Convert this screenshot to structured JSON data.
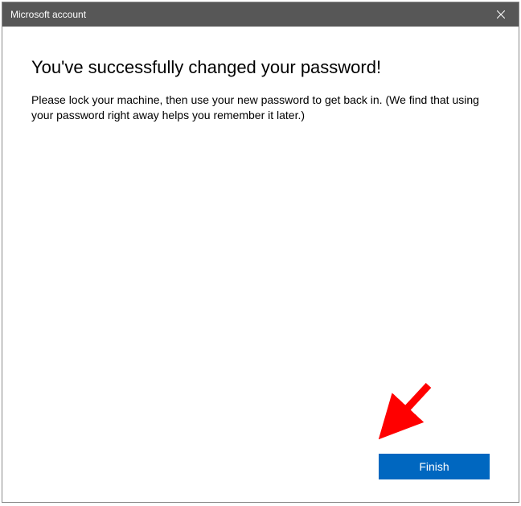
{
  "window": {
    "title": "Microsoft account"
  },
  "content": {
    "heading": "You've successfully changed your password!",
    "body": "Please lock your machine, then use your new password to get back in. (We find that using your password right away helps you remember it later.)"
  },
  "buttons": {
    "finish": "Finish"
  },
  "colors": {
    "titlebar": "#575757",
    "primary": "#0067c0",
    "annotation": "#ff0000"
  }
}
